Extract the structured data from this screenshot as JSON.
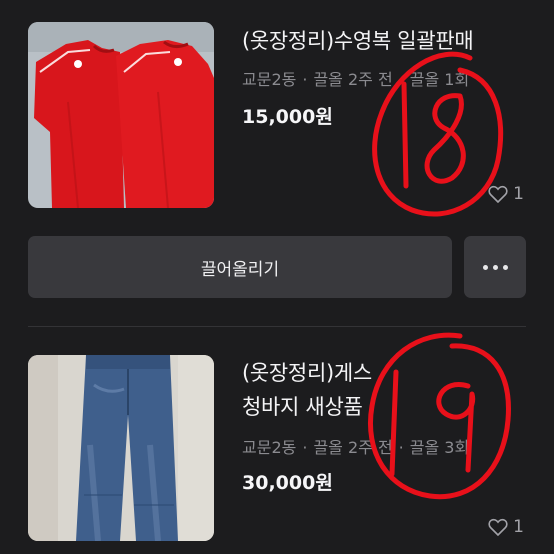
{
  "listings": [
    {
      "title_lines": [
        "(옷장정리)수영복 일괄판매"
      ],
      "location": "교문2동",
      "bumped": "끌올 2주 전",
      "bump_count": "끌올 1회",
      "price": "15,000원",
      "likes": "1",
      "image_desc": "red-swim-shirts-photo",
      "handwritten_note": "18"
    },
    {
      "title_lines": [
        "(옷장정리)게스",
        "청바지 새상품"
      ],
      "location": "교문2동",
      "bumped": "끌올 2주 전",
      "bump_count": "끌올 3회",
      "price": "30,000원",
      "likes": "1",
      "image_desc": "blue-jeans-photo",
      "handwritten_note": "19"
    }
  ],
  "actions": {
    "bump_label": "끌어올리기",
    "more_icon": "more-horizontal-icon"
  },
  "colors": {
    "background": "#1c1c1e",
    "button": "#39393d",
    "annotation": "#e8101a"
  }
}
